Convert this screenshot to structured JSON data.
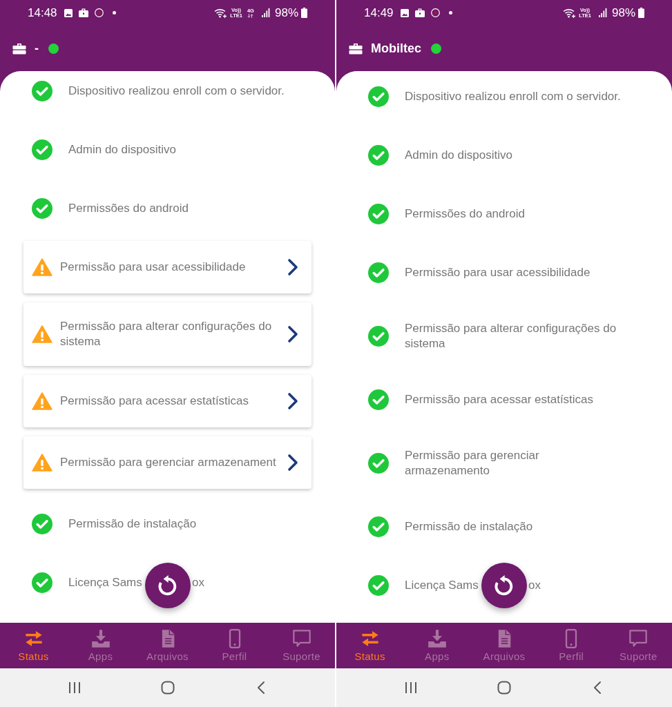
{
  "phones": [
    {
      "status_bar": {
        "time": "14:48",
        "volte": [
          "Vo))",
          "LTE1"
        ],
        "network": "4G",
        "battery": "98%"
      },
      "header": {
        "title": "-",
        "connected": true
      },
      "items": [
        {
          "label": "Dispositivo realizou enroll com o servidor.",
          "granted": true
        },
        {
          "label": "Admin do dispositivo",
          "granted": true
        },
        {
          "label": "Permissões do android",
          "granted": true
        },
        {
          "label": "Permissão para usar acessibilidade",
          "granted": false
        },
        {
          "label": "Permissão para alterar configurações do sistema",
          "granted": false
        },
        {
          "label": "Permissão para acessar estatísticas",
          "granted": false
        },
        {
          "label": "Permissão para gerenciar armazenament",
          "granted": false
        },
        {
          "label": "Permissão de instalação",
          "granted": true
        },
        {
          "label": "Licença Sams",
          "label_tail": "ox",
          "granted": true
        }
      ],
      "bottom_nav": [
        {
          "label": "Status",
          "selected": true
        },
        {
          "label": "Apps",
          "selected": false
        },
        {
          "label": "Arquivos",
          "selected": false
        },
        {
          "label": "Perfil",
          "selected": false
        },
        {
          "label": "Suporte",
          "selected": false
        }
      ]
    },
    {
      "status_bar": {
        "time": "14:49",
        "volte": [
          "Vo))",
          "LTE1"
        ],
        "battery": "98%"
      },
      "header": {
        "title": "Mobiltec",
        "connected": true
      },
      "items": [
        {
          "label": "Dispositivo realizou enroll com o servidor.",
          "granted": true
        },
        {
          "label": "Admin do dispositivo",
          "granted": true
        },
        {
          "label": "Permissões do android",
          "granted": true
        },
        {
          "label": "Permissão para usar acessibilidade",
          "granted": true
        },
        {
          "label": "Permissão para alterar configurações do sistema",
          "granted": true
        },
        {
          "label": "Permissão para acessar estatísticas",
          "granted": true
        },
        {
          "label": "Permissão para gerenciar armazenamento",
          "granted": true
        },
        {
          "label": "Permissão de instalação",
          "granted": true
        },
        {
          "label": "Licença Sams",
          "label_tail": "ox",
          "granted": true
        }
      ],
      "bottom_nav": [
        {
          "label": "Status",
          "selected": true
        },
        {
          "label": "Apps",
          "selected": false
        },
        {
          "label": "Arquivos",
          "selected": false
        },
        {
          "label": "Perfil",
          "selected": false
        },
        {
          "label": "Suporte",
          "selected": false
        }
      ]
    }
  ]
}
